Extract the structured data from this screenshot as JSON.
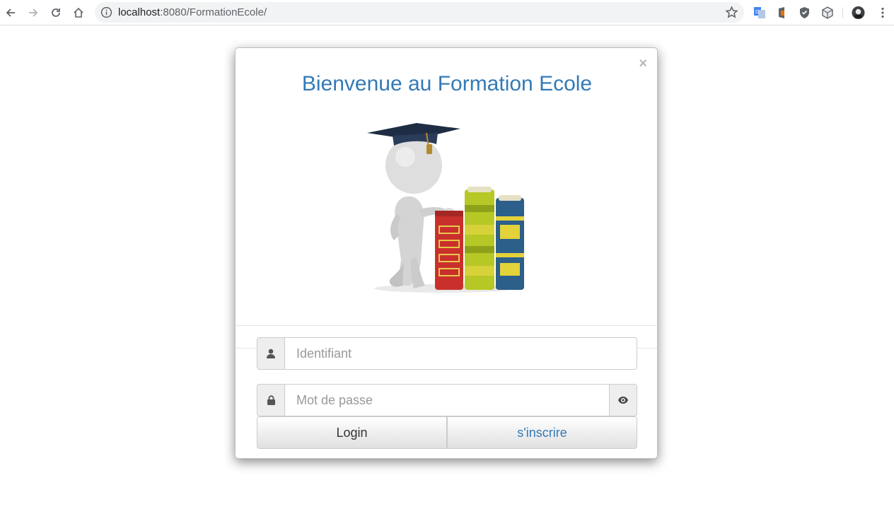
{
  "browser": {
    "url_host": "localhost",
    "url_path": ":8080/FormationEcole/"
  },
  "modal": {
    "close_symbol": "×",
    "title": "Bienvenue au Formation Ecole",
    "username_placeholder": "Identifiant",
    "password_placeholder": "Mot de passe",
    "login_label": "Login",
    "register_label": "s'inscrire"
  },
  "colors": {
    "title": "#337ab7",
    "link": "#337ab7"
  },
  "icons": {
    "username": "user-icon",
    "password": "lock-icon",
    "reveal": "eye-icon"
  }
}
